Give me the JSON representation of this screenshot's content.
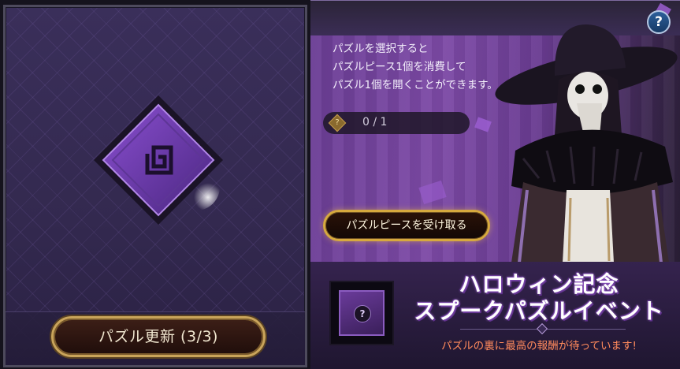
{
  "left_panel": {
    "refresh_button_label": "パズル更新 (3/3)"
  },
  "right_panel": {
    "description_lines": [
      "パズルを選択すると",
      "パズルピース1個を消費して",
      "パズル1個を開くことができます。"
    ],
    "piece_counter": "0 / 1",
    "receive_button_label": "パズルピースを受け取る",
    "help_label": "?"
  },
  "event": {
    "reward_icon_label": "?",
    "title_line1": "ハロウィン記念",
    "title_line2": "スプークパズルイベント",
    "subtitle": "パズルの裏に最高の報酬が待っています!"
  },
  "colors": {
    "accent_gold": "#c9a45a",
    "panel_purple": "#3a2f5a",
    "subtitle_orange": "#ff8a5c"
  },
  "icons": [
    "puzzle-tile-icon",
    "puzzle-piece-icon",
    "help-icon",
    "question-icon"
  ]
}
